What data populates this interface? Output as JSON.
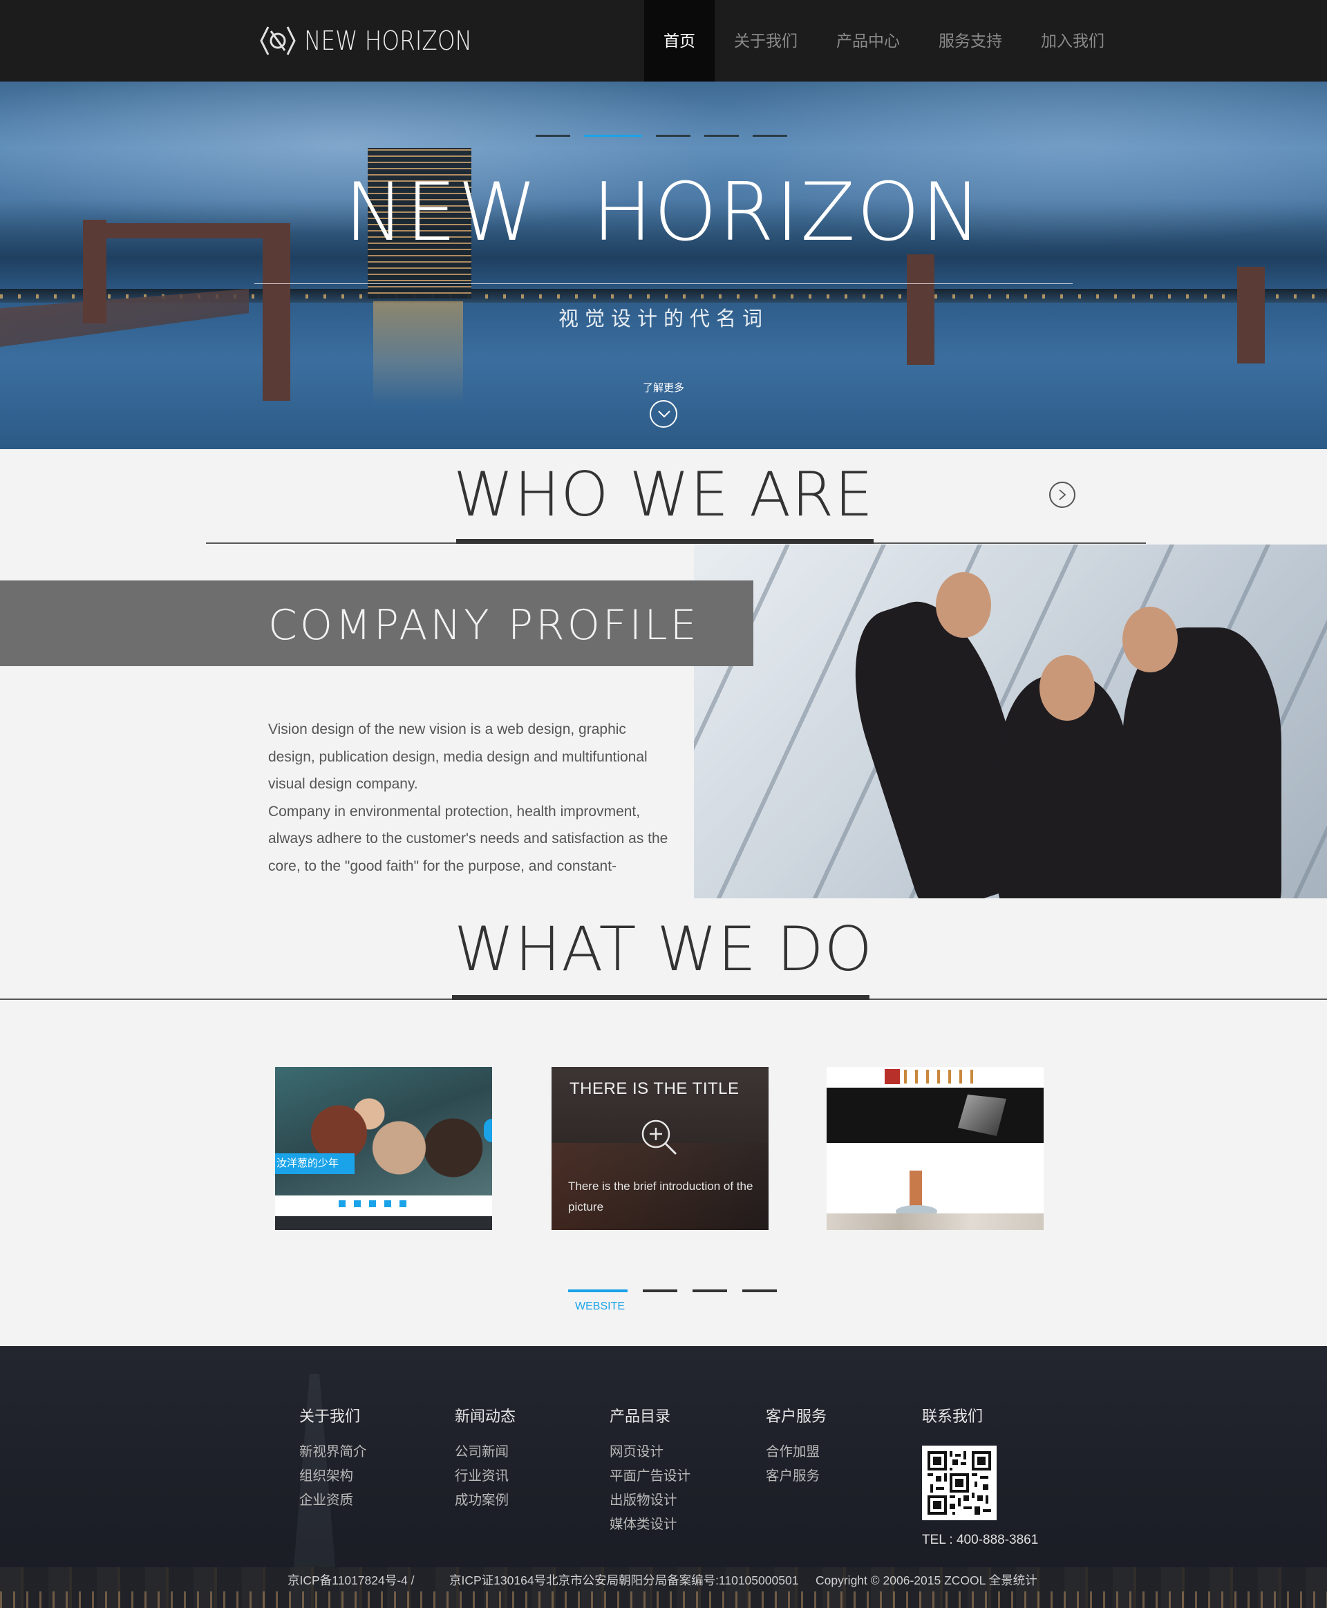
{
  "header": {
    "logo_text": "NEW HORIZON",
    "nav": [
      {
        "label": "首页"
      },
      {
        "label": "关于我们"
      },
      {
        "label": "产品中心"
      },
      {
        "label": "服务支持"
      },
      {
        "label": "加入我们"
      }
    ],
    "active_nav": 0
  },
  "hero": {
    "title": "NEW  HORIZON",
    "subtitle": "视觉设计的代名词",
    "more_label": "了解更多",
    "slide_count": 5,
    "active_slide": 1
  },
  "who": {
    "title": "WHO WE ARE",
    "profile_heading": "COMPANY PROFILE",
    "paragraphs": [
      "Vision design of the new vision is a web design, graphic design, publication design, media design and multifuntional visual design company.",
      "Company in environmental protection, health improvment, always adhere to the customer's needs and satisfaction as the core, to the \"good faith\" for the purpose, and constant-"
    ]
  },
  "what": {
    "title": "WHAT WE DO",
    "cards": [
      {
        "tag": "汝洋葱的少年"
      },
      {
        "title": "THERE IS THE TITLE",
        "description": "There is the brief introduction of the picture"
      },
      {}
    ],
    "tab_label": "WEBSITE",
    "tab_count": 4,
    "active_tab": 0
  },
  "footer": {
    "columns": [
      {
        "title": "关于我们",
        "links": [
          "新视界简介",
          "组织架构",
          "企业资质"
        ]
      },
      {
        "title": "新闻动态",
        "links": [
          "公司新闻",
          "行业资讯",
          "成功案例"
        ]
      },
      {
        "title": "产品目录",
        "links": [
          "网页设计",
          "平面广告设计",
          "出版物设计",
          "媒体类设计"
        ]
      },
      {
        "title": "客户服务",
        "links": [
          "合作加盟",
          "客户服务"
        ]
      }
    ],
    "contact_title": "联系我们",
    "tel": "TEL : 400-888-3861",
    "icp1": "京ICP备11017824号-4 /",
    "icp2": "京ICP证130164号北京市公安局朝阳分局备案编号:110105000501",
    "copyright": "Copyright © 2006-2015 ZCOOL 全景统计"
  },
  "colors": {
    "accent": "#1aa3e8",
    "header_bg": "#1c1c1c",
    "banner_gray": "#6e6e6e",
    "footer_bg": "#1e2029"
  },
  "icons": {
    "logo": "hexagon-logo-icon",
    "hero_down": "chevron-down-circle-icon",
    "who_next": "chevron-right-circle-icon",
    "card_zoom": "zoom-in-icon"
  }
}
